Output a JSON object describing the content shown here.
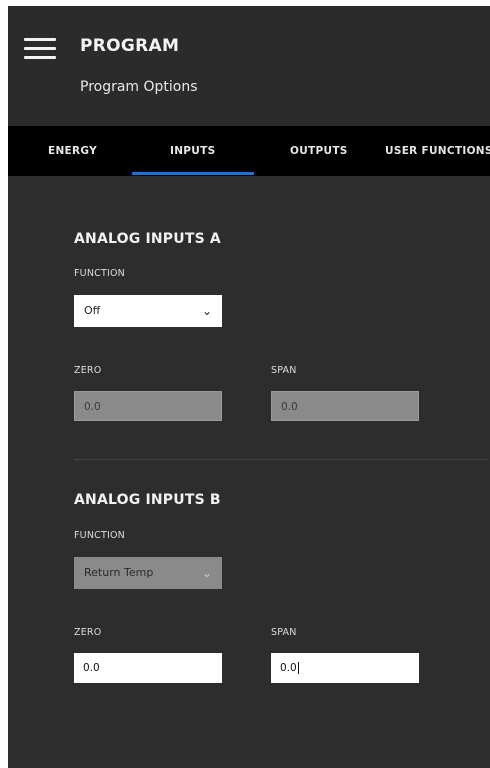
{
  "header": {
    "title": "PROGRAM",
    "subtitle": "Program Options"
  },
  "tabs": [
    {
      "label": "ENERGY",
      "active": false
    },
    {
      "label": "INPUTS",
      "active": true
    },
    {
      "label": "OUTPUTS",
      "active": false
    },
    {
      "label": "USER FUNCTIONS",
      "active": false
    }
  ],
  "colors": {
    "accent": "#1a73d9",
    "background": "#2d2d2d",
    "tabbar": "#000000"
  },
  "analog_a": {
    "title": "ANALOG INPUTS A",
    "function_label": "FUNCTION",
    "function_value": "Off",
    "zero_label": "ZERO",
    "zero_value": "0.0",
    "span_label": "SPAN",
    "span_value": "0.0"
  },
  "analog_b": {
    "title": "ANALOG INPUTS B",
    "function_label": "FUNCTION",
    "function_value": "Return Temp",
    "zero_label": "ZERO",
    "zero_value": "0.0",
    "span_label": "SPAN",
    "span_value": "0.0"
  },
  "icons": {
    "menu": "hamburger-menu-icon",
    "chevron": "chevron-down-icon"
  }
}
